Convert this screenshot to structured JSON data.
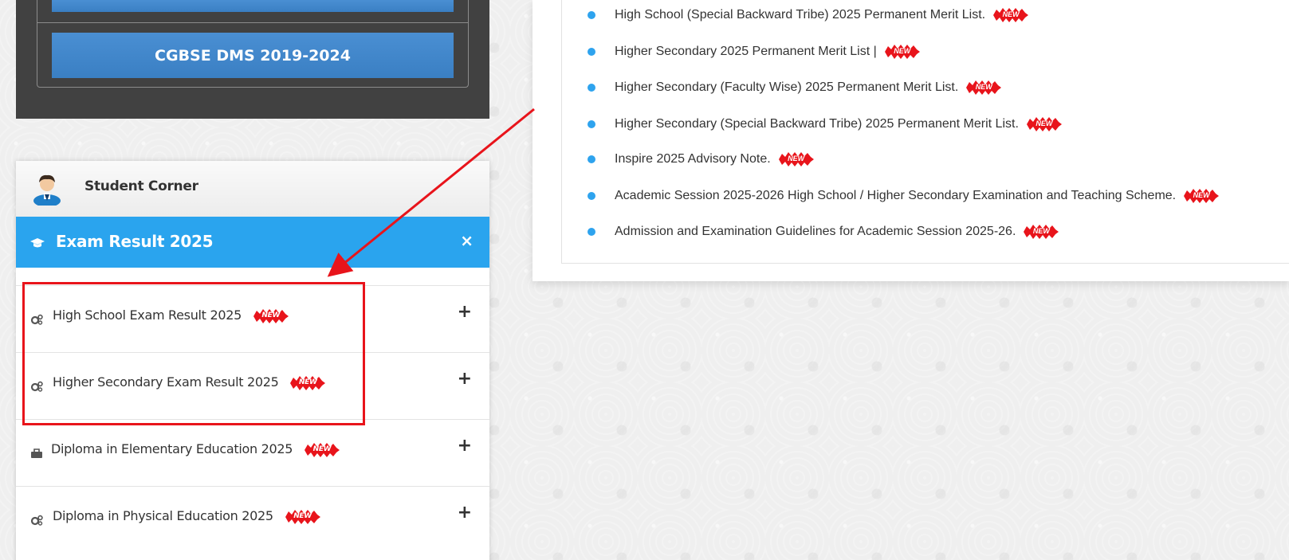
{
  "dms": {
    "button_label": "CGBSE DMS 2019-2024"
  },
  "student_corner": {
    "title": "Student Corner"
  },
  "exam_result": {
    "title": "Exam Result 2025",
    "close_glyph": "×",
    "items": [
      {
        "label": "High School Exam Result 2025",
        "badge": "NEW",
        "icon": "cogs-icon",
        "expand_glyph": "+"
      },
      {
        "label": "Higher Secondary Exam Result 2025",
        "badge": "NEW",
        "icon": "cogs-icon",
        "expand_glyph": "+"
      },
      {
        "label": "Diploma in Elementary Education 2025",
        "badge": "NEW",
        "icon": "bag-icon",
        "expand_glyph": "+"
      },
      {
        "label": "Diploma in Physical Education 2025",
        "badge": "NEW",
        "icon": "cogs-icon",
        "expand_glyph": "+"
      }
    ]
  },
  "notices": [
    {
      "text": "High School (Special Backward Tribe) 2025 Permanent Merit List.",
      "badge": "NEW"
    },
    {
      "text": "Higher Secondary 2025 Permanent Merit List |",
      "badge": "NEW"
    },
    {
      "text": "Higher Secondary (Faculty Wise) 2025 Permanent Merit List.",
      "badge": "NEW"
    },
    {
      "text": "Higher Secondary (Special Backward Tribe) 2025 Permanent Merit List.",
      "badge": "NEW"
    },
    {
      "text": "Inspire 2025 Advisory Note.",
      "badge": "NEW"
    },
    {
      "text": "Academic Session 2025-2026 High School / Higher Secondary Examination and Teaching Scheme.",
      "badge": "NEW"
    },
    {
      "text": "Admission and Examination Guidelines for Academic Session 2025-26.",
      "badge": "NEW"
    }
  ],
  "colors": {
    "accent_blue": "#2aa4ee",
    "button_blue": "#3f84c8",
    "dark_panel": "#414141",
    "badge_red": "#e8141b",
    "annotation_red": "#e8141b"
  }
}
